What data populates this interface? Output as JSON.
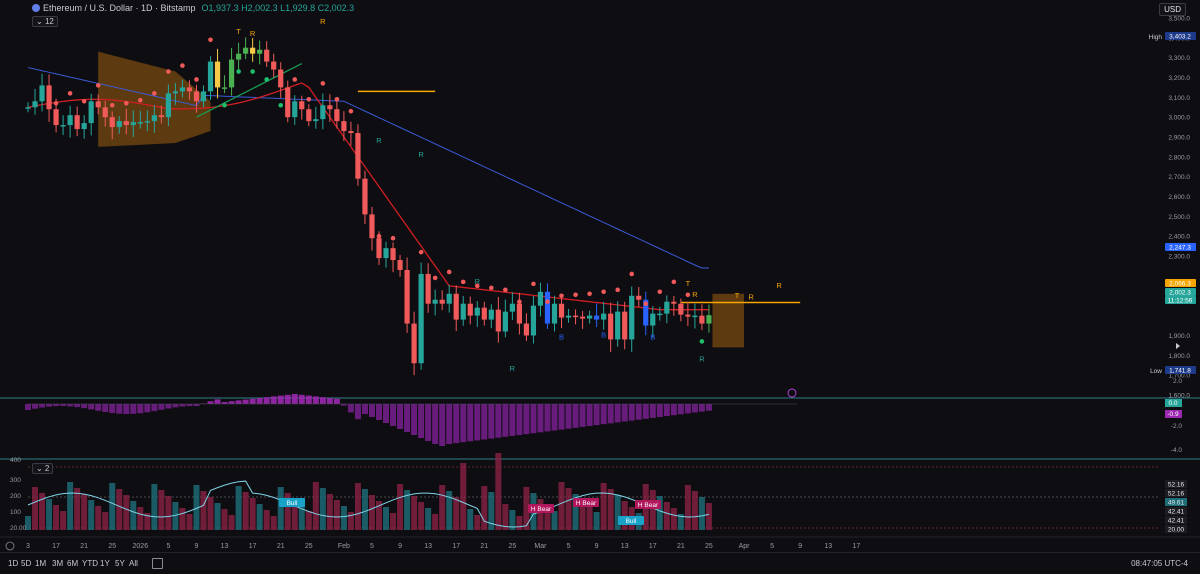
{
  "header": {
    "symbol": "Ethereum / U.S. Dollar · 1D · Bitstamp",
    "ohlc": "O1,937.3 H2,002.3 L1,929.8 C2,002.3",
    "collapse_label": "12"
  },
  "currency_button": "USD",
  "chart_data": [
    {
      "type": "candlestick",
      "title": "Ethereum / U.S. Dollar · 1D · Bitstamp",
      "y_ticks": [
        "3,500.0",
        "3,400.0",
        "3,300.0",
        "3,200.0",
        "3,100.0",
        "3,000.0",
        "2,900.0",
        "2,800.0",
        "2,700.0",
        "2,600.0",
        "2,500.0",
        "2,400.0",
        "2,300.0",
        "2,100.0",
        "1,900.0",
        "1,800.0",
        "1,700.0",
        "1,600.0"
      ],
      "ylim": [
        1600,
        3540
      ],
      "price_labels": [
        {
          "name": "High",
          "value": "3,403.2",
          "color": "#1e3a8a"
        },
        {
          "name": "ma",
          "value": "2,247.3",
          "color": "#2962ff"
        },
        {
          "name": "res",
          "value": "2,066.3",
          "color": "#f7a600"
        },
        {
          "name": "last",
          "value": "2,002.3",
          "color": "#26a69a"
        },
        {
          "name": "countdown",
          "value": "11:12:56",
          "color": "#26a69a"
        },
        {
          "name": "Low",
          "value": "1,741.8",
          "color": "#1e3a8a"
        }
      ],
      "x_ticks": [
        "3",
        "17",
        "21",
        "25",
        "2026",
        "5",
        "9",
        "13",
        "17",
        "21",
        "25",
        "Feb",
        "5",
        "9",
        "13",
        "17",
        "21",
        "25",
        "Mar",
        "5",
        "9",
        "13",
        "17",
        "21",
        "25",
        "Apr",
        "5",
        "9",
        "13",
        "17"
      ],
      "x_index": [
        0,
        4,
        8,
        12,
        16,
        20,
        24,
        28,
        32,
        36,
        40,
        45,
        49,
        53,
        57,
        61,
        65,
        69,
        73,
        77,
        81,
        85,
        89,
        93,
        97,
        102,
        106,
        110,
        114,
        118
      ],
      "candles_close": [
        3050,
        3080,
        3160,
        3040,
        2960,
        2960,
        3010,
        2940,
        2970,
        3080,
        3050,
        3000,
        2950,
        2980,
        2960,
        2975,
        2975,
        2980,
        3010,
        3000,
        3120,
        3130,
        3150,
        3130,
        3080,
        3130,
        3280,
        3150,
        3150,
        3290,
        3320,
        3350,
        3320,
        3340,
        3280,
        3240,
        3150,
        3000,
        3080,
        3040,
        2980,
        2990,
        3060,
        3040,
        2980,
        2930,
        2920,
        2690,
        2510,
        2390,
        2290,
        2340,
        2280,
        2230,
        1960,
        1760,
        2210,
        2060,
        2080,
        2060,
        2110,
        1980,
        2060,
        2000,
        2040,
        1980,
        2030,
        1920,
        2020,
        2060,
        1960,
        1900,
        2050,
        2120,
        1960,
        2060,
        1990,
        2000,
        1995,
        1985,
        2000,
        1980,
        2010,
        1880,
        2020,
        1880,
        2100,
        2080,
        1950,
        2010,
        2010,
        2070,
        2060,
        2005,
        1995,
        2000,
        1960,
        2002
      ],
      "series": [
        {
          "name": "",
          "values": []
        }
      ],
      "signal_labels": [
        "T",
        "R",
        "R",
        "R",
        "R",
        "R",
        "R",
        "B",
        "B",
        "B",
        "T",
        "R",
        "R",
        "T",
        "R",
        "R"
      ],
      "osc1": {
        "y_ticks": [
          "2.0",
          "-2.0",
          "-4.0"
        ],
        "labels": [
          "0.0",
          "-0.9"
        ]
      },
      "osc2": {
        "y_ticks": [
          "400",
          "300",
          "200",
          "100",
          "20.00"
        ],
        "labels": [
          "52.16",
          "52.16",
          "49.61",
          "42.41",
          "42.41",
          "20.00"
        ],
        "tags": [
          "Bull",
          "H Bear",
          "H Bear",
          "Bull",
          "H Bear"
        ]
      }
    }
  ],
  "bottom_bar": {
    "timeframes": [
      "1D",
      "5D",
      "1M",
      "3M",
      "6M",
      "YTD",
      "1Y",
      "5Y",
      "All"
    ],
    "clock": "08:47:05 UTC-4"
  }
}
